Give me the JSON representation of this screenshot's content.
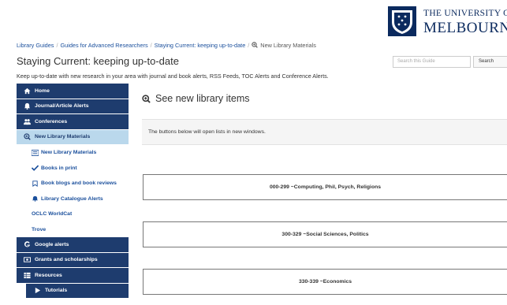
{
  "logo": {
    "line1": "THE UNIVERSITY OF",
    "line2": "MELBOURNE"
  },
  "breadcrumb": {
    "items": [
      "Library Guides",
      "Guides for Advanced Researchers",
      "Staying Current: keeping up-to-date"
    ],
    "current": "New Library Materials"
  },
  "page": {
    "title": "Staying Current: keeping up-to-date",
    "description": "Keep up-to-date with new research in your area with journal and book alerts, RSS Feeds, TOC Alerts and Conference Alerts."
  },
  "search": {
    "placeholder": "Search this Guide",
    "button": "Search"
  },
  "sidebar": {
    "items": [
      {
        "label": "Home",
        "icon": "home-icon",
        "style": "dark"
      },
      {
        "label": "Journal/Article Alerts",
        "icon": "bell-icon",
        "style": "dark"
      },
      {
        "label": "Conferences",
        "icon": "users-icon",
        "style": "dark"
      },
      {
        "label": "New Library Materials",
        "icon": "search-plus-icon",
        "style": "active"
      }
    ],
    "subitems": [
      {
        "label": "New Library Materials",
        "icon": "list-icon"
      },
      {
        "label": "Books in print",
        "icon": "check-icon"
      },
      {
        "label": "Book blogs and book reviews",
        "icon": "bookmark-icon"
      },
      {
        "label": "Library Catalogue Alerts",
        "icon": "bell-icon"
      },
      {
        "label": "OCLC WorldCat",
        "icon": ""
      },
      {
        "label": "Trove",
        "icon": ""
      }
    ],
    "lower_items": [
      {
        "label": "Google alerts",
        "icon": "google-icon"
      },
      {
        "label": "Grants and scholarships",
        "icon": "money-icon"
      },
      {
        "label": "Resources",
        "icon": "table-icon"
      }
    ],
    "tutorials": {
      "label": "Tutorials",
      "icon": "play-icon"
    }
  },
  "main": {
    "title": "See new library items",
    "notice": "The buttons below will open lists in new windows.",
    "buttons": [
      "000-299 ~Computing, Phil, Psych, Religions",
      "300-329 ~Social Sciences, Politics",
      "330-339 ~Economics"
    ]
  },
  "colors": {
    "nav_dark": "#1e3c6e",
    "nav_active": "#bad8ec",
    "link": "#1a4f9c"
  }
}
